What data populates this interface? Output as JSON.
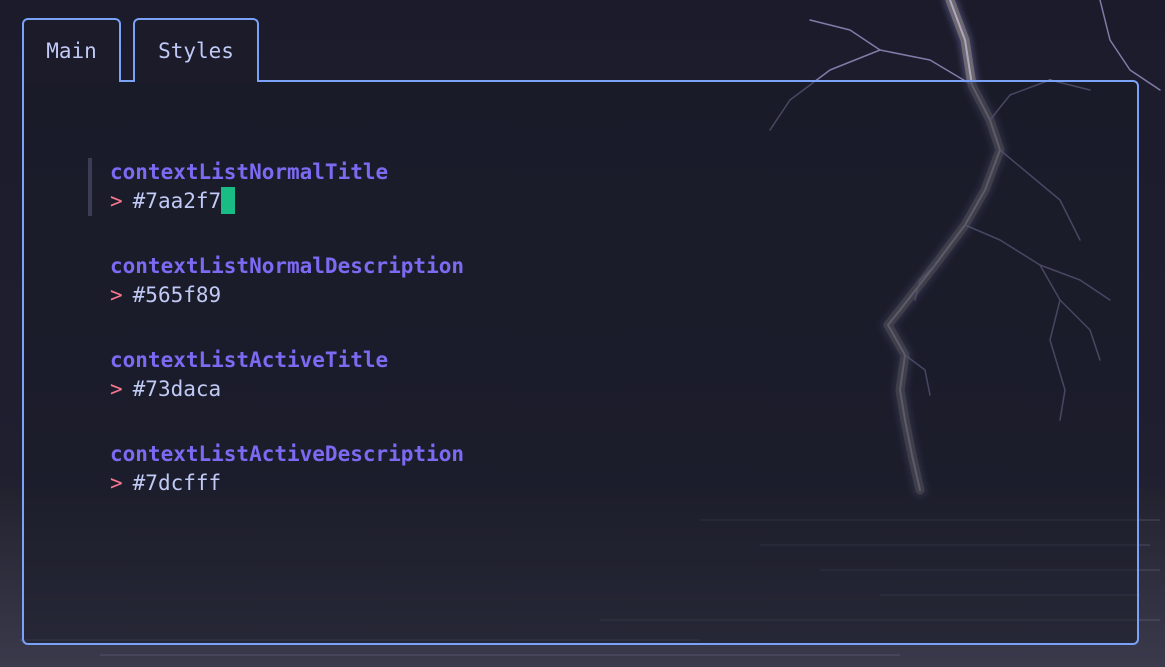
{
  "tabs": [
    {
      "label": "Main",
      "active": false
    },
    {
      "label": "Styles",
      "active": true
    }
  ],
  "styles": {
    "prompt_symbol": ">",
    "entries": [
      {
        "key": "contextListNormalTitle",
        "value": "#7aa2f7",
        "selected": true
      },
      {
        "key": "contextListNormalDescription",
        "value": "#565f89",
        "selected": false
      },
      {
        "key": "contextListActiveTitle",
        "value": "#73daca",
        "selected": false
      },
      {
        "key": "contextListActiveDescription",
        "value": "#7dcfff",
        "selected": false
      }
    ]
  },
  "colors": {
    "border": "#7aa2f7",
    "key_text": "#7c6af2",
    "prompt": "#f7768e",
    "value_text": "#c0caf5",
    "cursor": "#1abc86",
    "selection_bar": "#3b3d57",
    "background": "#1b1b2a"
  }
}
